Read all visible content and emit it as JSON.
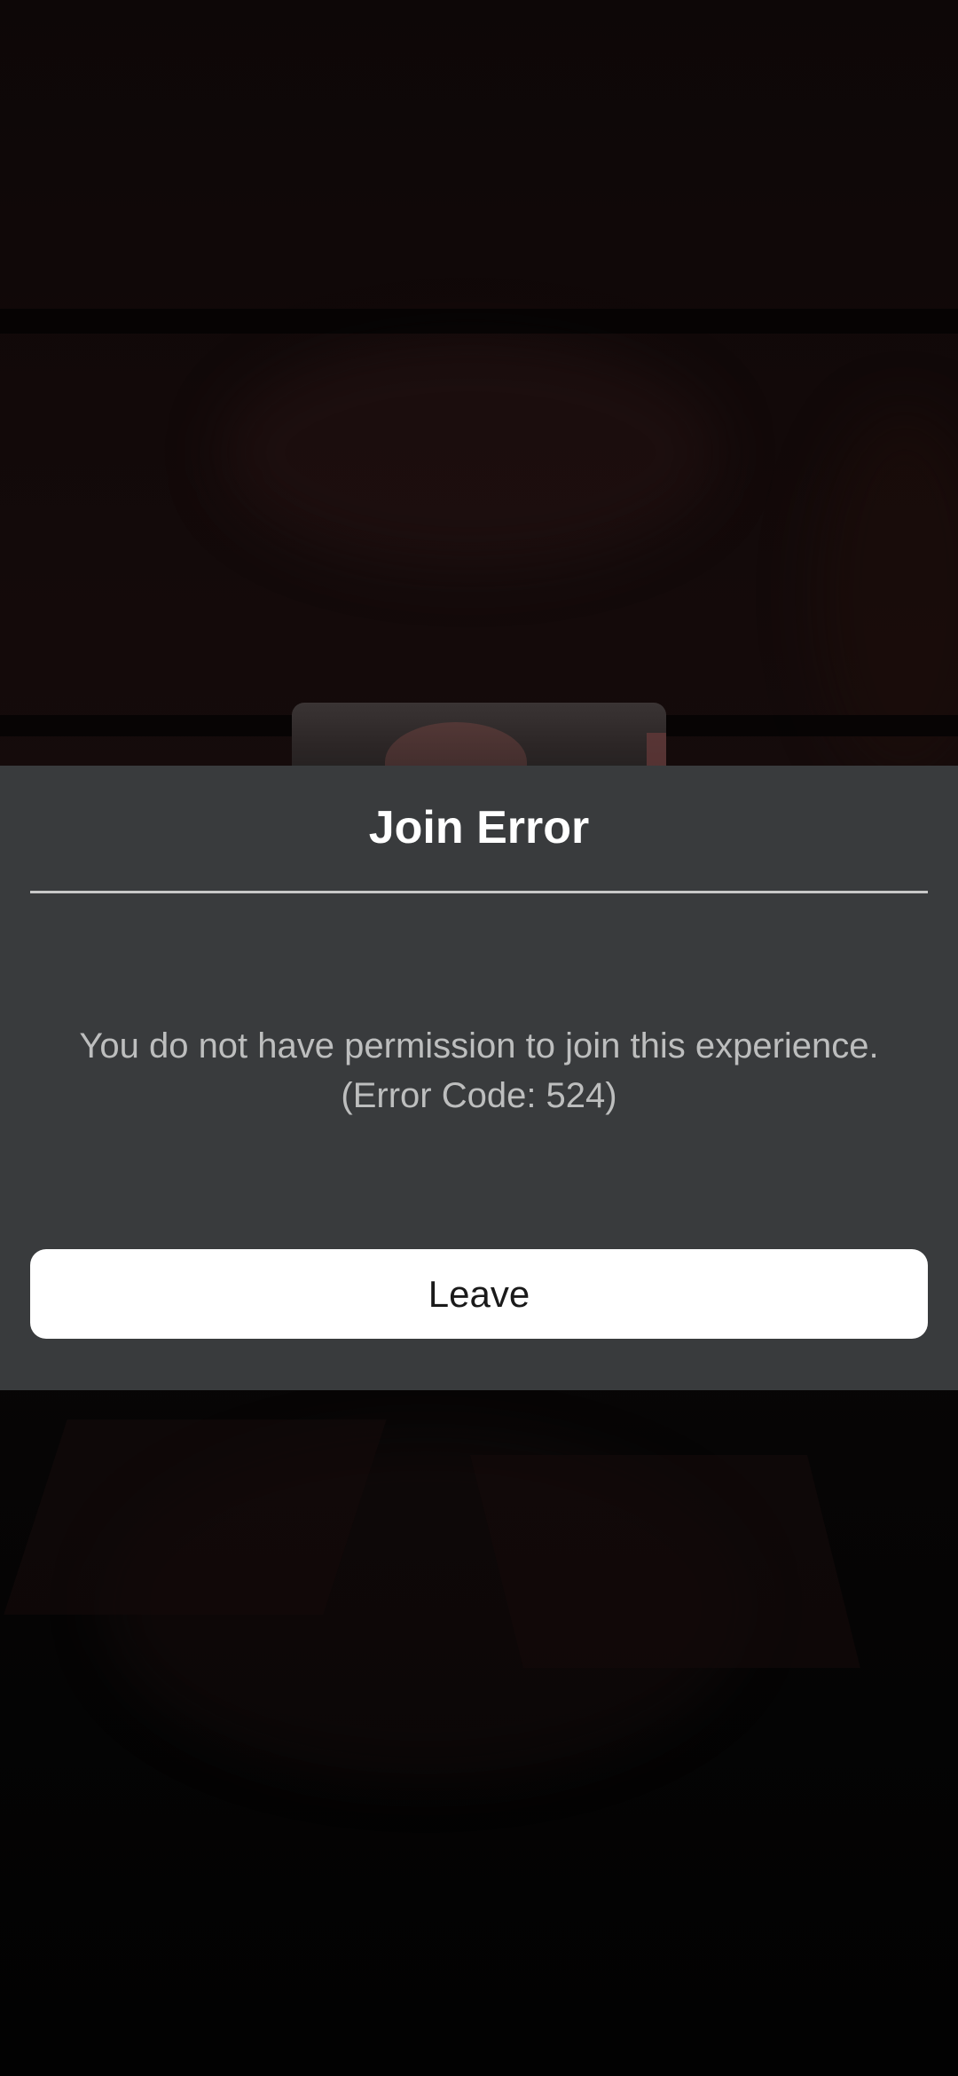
{
  "dialog": {
    "title": "Join Error",
    "message_line1": "You do not have permission to join this experience.",
    "message_line2": "(Error Code: 524)",
    "leave_label": "Leave"
  },
  "colors": {
    "dialog_background": "#393b3d",
    "title_text": "#ffffff",
    "message_text": "#bdbebe",
    "button_background": "#ffffff",
    "button_text": "#1a1a1a"
  }
}
